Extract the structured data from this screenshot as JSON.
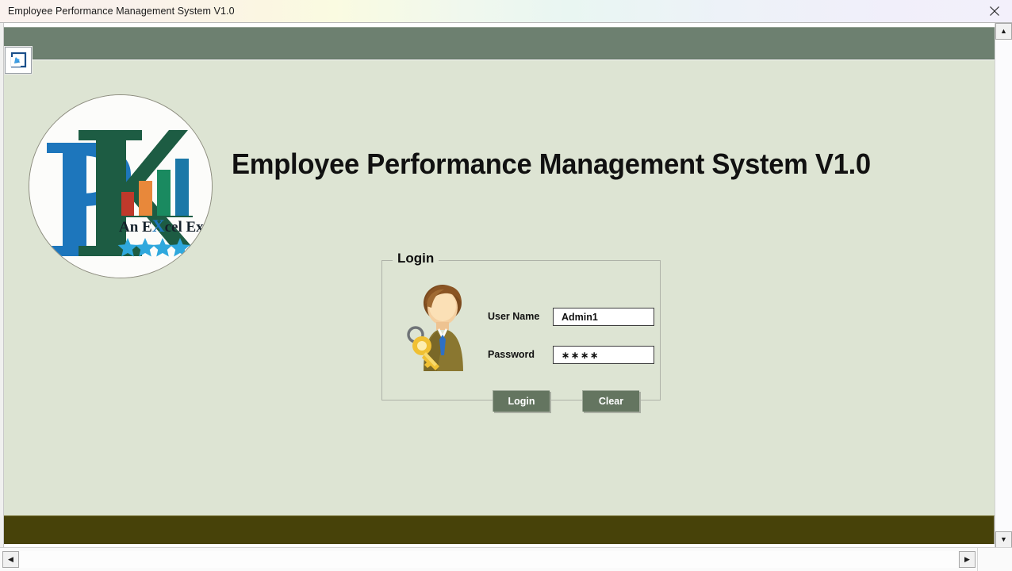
{
  "window": {
    "title": "Employee Performance Management System V1.0",
    "close_icon": "close-icon"
  },
  "toolbar": {
    "restore_icon": "restore-window-icon"
  },
  "branding": {
    "logo_initials": "PK",
    "logo_tagline": "An EXcel Expert",
    "logo_tagline_highlight": "X",
    "logo_star_count": 5,
    "logo_star_color": "#2fa8dd",
    "logo_letter_p_color": "#1d76bc",
    "logo_letter_k_color": "#1d5c43",
    "logo_bar_colors": [
      "#c0392b",
      "#e8883a",
      "#1a8a60",
      "#1b78a8"
    ]
  },
  "main": {
    "app_title": "Employee Performance Management System V1.0"
  },
  "login": {
    "group_title": "Login",
    "avatar_icon": "user-with-key-icon",
    "username_label": "User Name",
    "username_value": "Admin1",
    "username_placeholder": "",
    "password_label": "Password",
    "password_value": "∗∗∗∗",
    "password_placeholder": "",
    "login_button_label": "Login",
    "clear_button_label": "Clear"
  },
  "scrollbars": {
    "up_arrow": "▲",
    "down_arrow": "▼",
    "left_arrow": "◀",
    "right_arrow": "▶"
  },
  "colors": {
    "header_band": "#6d8070",
    "form_background": "#dde4d3",
    "footer_band": "#474209",
    "button_face": "#647560",
    "title_text": "#111111"
  }
}
